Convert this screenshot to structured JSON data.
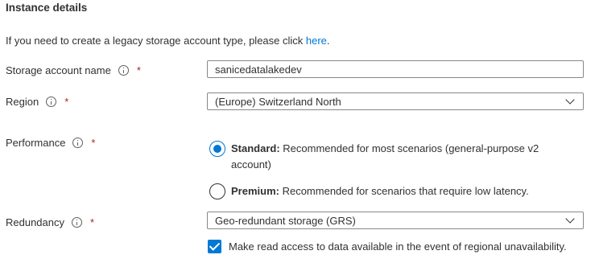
{
  "section": {
    "title": "Instance details"
  },
  "intro": {
    "text": "If you need to create a legacy storage account type, please click ",
    "link": "here",
    "suffix": "."
  },
  "storage_account_name": {
    "label": "Storage account name",
    "required_mark": "*",
    "value": "sanicedatalakedev"
  },
  "region": {
    "label": "Region",
    "required_mark": "*",
    "value": "(Europe) Switzerland North"
  },
  "performance": {
    "label": "Performance",
    "required_mark": "*",
    "options": [
      {
        "title": "Standard:",
        "description": " Recommended for most scenarios (general-purpose v2 account)",
        "selected": true
      },
      {
        "title": "Premium:",
        "description": " Recommended for scenarios that require low latency.",
        "selected": false
      }
    ]
  },
  "redundancy": {
    "label": "Redundancy",
    "required_mark": "*",
    "value": "Geo-redundant storage (GRS)",
    "read_access_checkbox": {
      "label": "Make read access to data available in the event of regional unavailability.",
      "checked": true
    }
  },
  "colors": {
    "accent": "#0078d4",
    "required": "#a4262c",
    "text": "#323130",
    "border": "#8a8886"
  }
}
